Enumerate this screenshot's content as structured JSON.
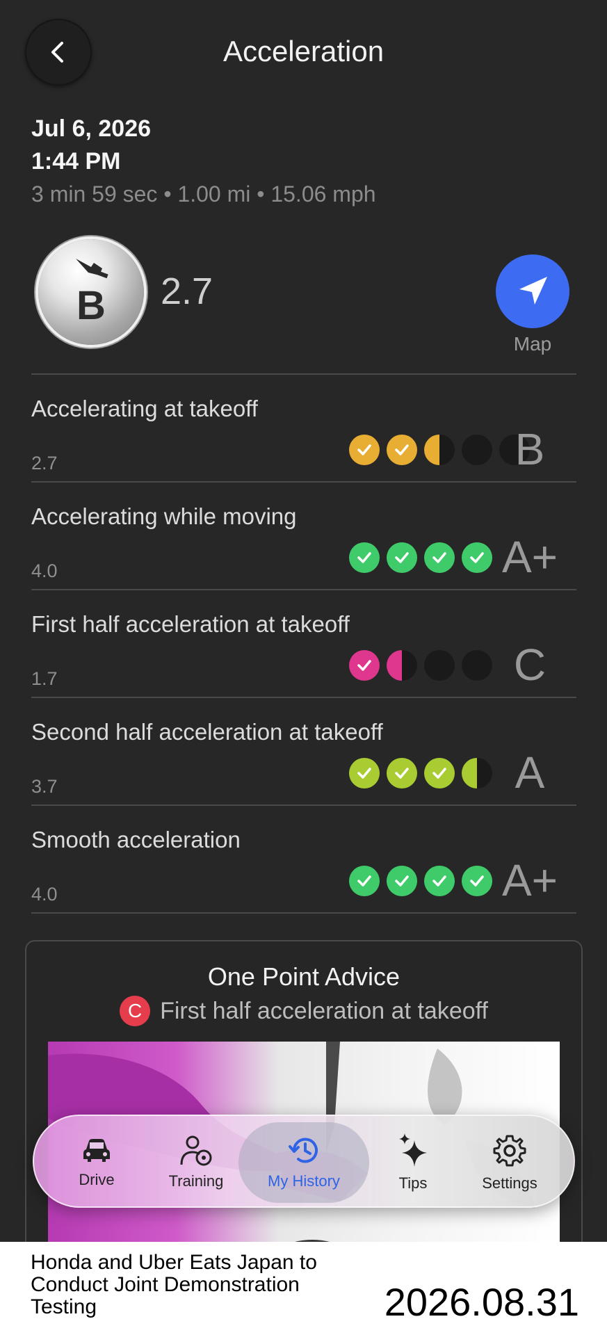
{
  "header": {
    "title": "Acceleration",
    "back_icon": "chevron-left-icon"
  },
  "trip": {
    "date": "Jul 6, 2026",
    "time": "1:44 PM",
    "meta": "3 min 59 sec • 1.00 mi • 15.06 mph"
  },
  "overall": {
    "grade": "B",
    "score": "2.7",
    "icon": "hand-pedal-icon"
  },
  "map": {
    "label": "Map",
    "icon": "navigation-arrow-icon"
  },
  "metrics": [
    {
      "label": "Accelerating at takeoff",
      "score": "2.7",
      "grade": "B",
      "color": "#e8ae33",
      "dots": [
        "full",
        "full",
        "half",
        "empty",
        "empty"
      ]
    },
    {
      "label": "Accelerating while moving",
      "score": "4.0",
      "grade": "A+",
      "color": "#3fcb6a",
      "dots": [
        "full",
        "full",
        "full",
        "full"
      ]
    },
    {
      "label": "First half acceleration at takeoff",
      "score": "1.7",
      "grade": "C",
      "color": "#e0378e",
      "dots": [
        "full",
        "half",
        "empty",
        "empty"
      ]
    },
    {
      "label": "Second half acceleration at takeoff",
      "score": "3.7",
      "grade": "A",
      "color": "#a9cc33",
      "dots": [
        "full",
        "full",
        "full",
        "half"
      ]
    },
    {
      "label": "Smooth acceleration",
      "score": "4.0",
      "grade": "A+",
      "color": "#3fcb6a",
      "dots": [
        "full",
        "full",
        "full",
        "full"
      ]
    }
  ],
  "advice": {
    "title": "One Point Advice",
    "grade": "C",
    "grade_color": "#e53d4c",
    "subject": "First half acceleration at takeoff"
  },
  "tabs": [
    {
      "label": "Drive",
      "icon": "car-icon",
      "active": false
    },
    {
      "label": "Training",
      "icon": "driver-person-icon",
      "active": false
    },
    {
      "label": "My History",
      "icon": "history-clock-icon",
      "active": true
    },
    {
      "label": "Tips",
      "icon": "sparkles-icon",
      "active": false
    },
    {
      "label": "Settings",
      "icon": "gear-icon",
      "active": false
    }
  ],
  "footer": {
    "caption": "Honda and Uber Eats Japan to Conduct Joint Demonstration Testing",
    "date": "2026.08.31"
  }
}
